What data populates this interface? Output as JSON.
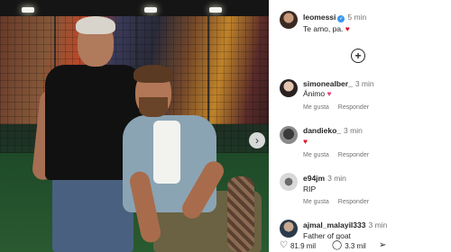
{
  "post": {
    "author": "leomessi",
    "time": "5 min",
    "caption": "Te amo, pa.",
    "caption_emoji": "♥"
  },
  "comments": [
    {
      "user": "simonealber_",
      "time": "3 min",
      "text": "Ánimo",
      "emoji": "♥",
      "like_label": "Me gusta",
      "reply_label": "Responder"
    },
    {
      "user": "dandieko_",
      "time": "3 min",
      "text": "",
      "emoji": "♥",
      "like_label": "Me gusta",
      "reply_label": "Responder"
    },
    {
      "user": "e94jm",
      "time": "3 min",
      "text": "RIP",
      "emoji": "",
      "like_label": "Me gusta",
      "reply_label": "Responder"
    },
    {
      "user": "ajmal_malayil333",
      "time": "3 min",
      "text": "Father of goat",
      "emoji": ""
    }
  ],
  "actions": {
    "likes": "81.9 mil",
    "comments": "3.3 mil"
  },
  "icons": {
    "add": "plus-circle-icon",
    "next": "chevron-right-icon",
    "verified": "verified-badge-icon",
    "like": "heart-icon",
    "comment": "comment-icon",
    "share": "send-icon"
  }
}
